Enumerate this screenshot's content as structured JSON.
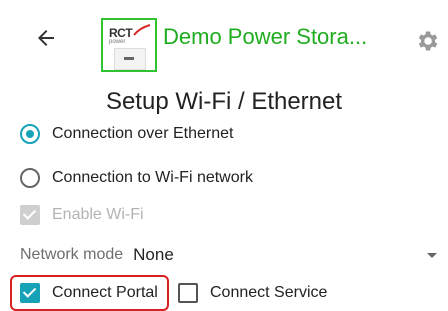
{
  "header": {
    "app_title": "Demo Power Stora...",
    "logo_text": "RCT",
    "logo_subtext": "power"
  },
  "page": {
    "title": "Setup Wi-Fi / Ethernet"
  },
  "options": {
    "ethernet_label": "Connection over Ethernet",
    "wifi_label": "Connection to Wi-Fi network",
    "enable_wifi_label": "Enable Wi-Fi",
    "network_mode_label": "Network mode",
    "network_mode_value": "None",
    "connect_portal_label": "Connect Portal",
    "connect_service_label": "Connect Service"
  },
  "colors": {
    "accent": "#17a2b8",
    "title_green": "#1fad1f",
    "highlight_red": "#d92020"
  }
}
